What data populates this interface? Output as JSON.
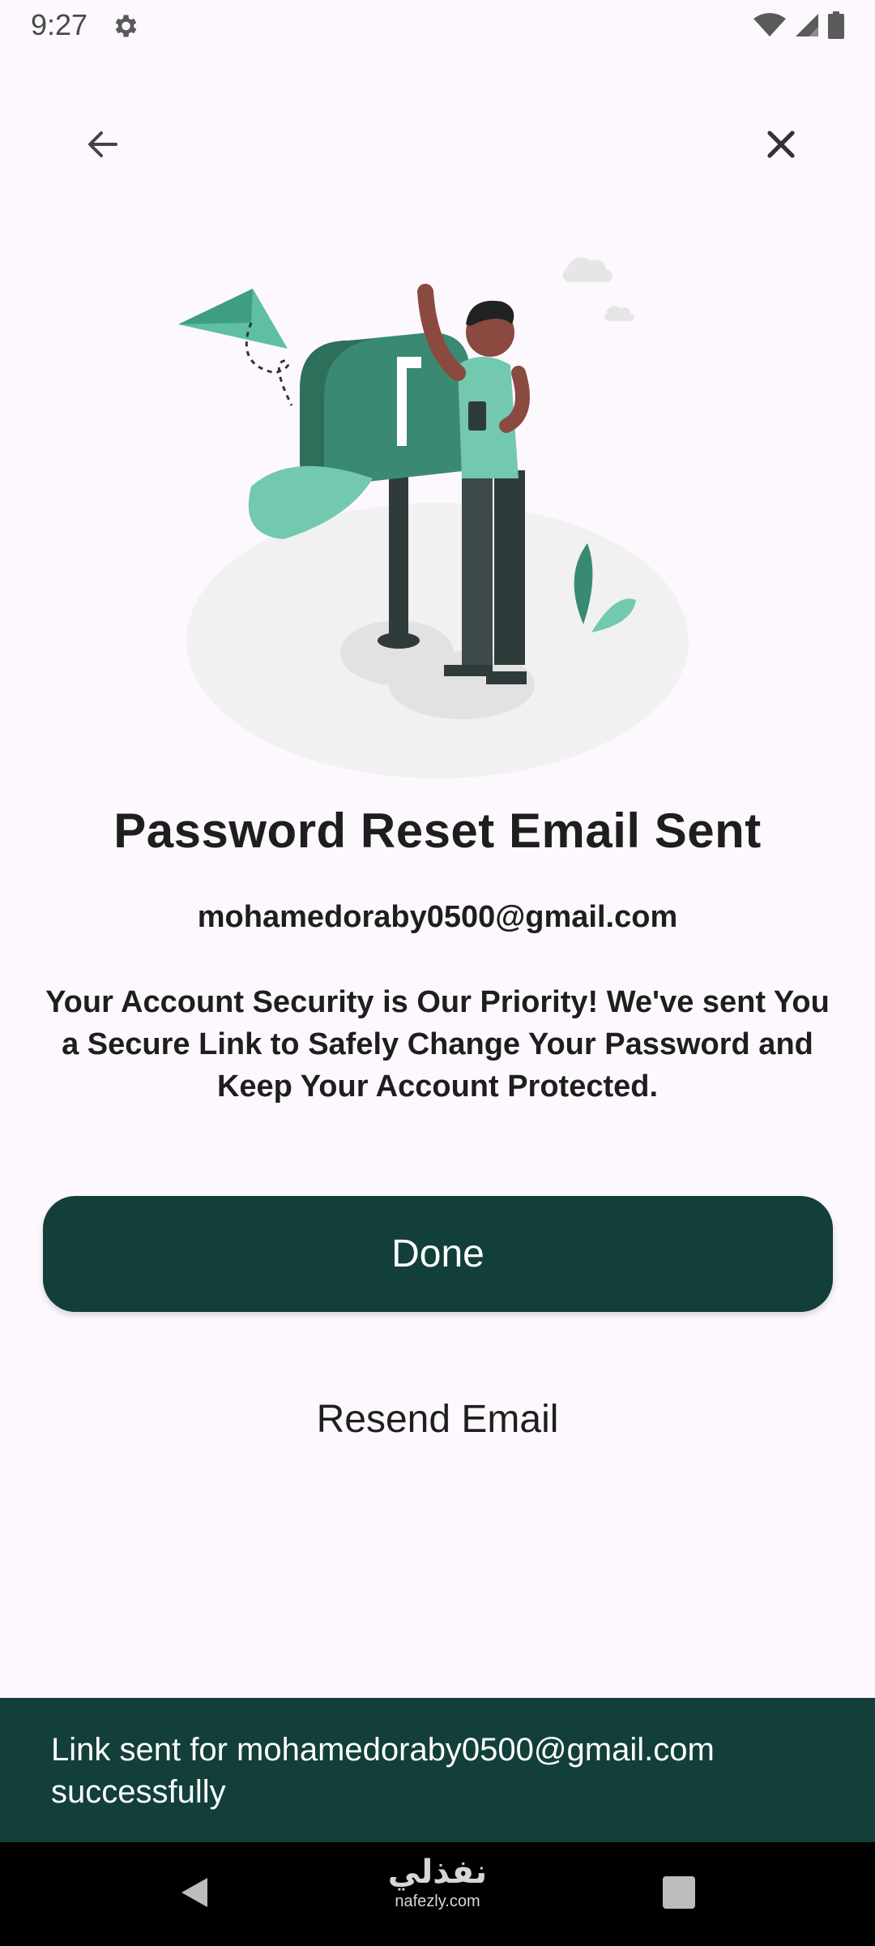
{
  "status_bar": {
    "time": "9:27",
    "icons": [
      "gear-icon",
      "wifi-icon",
      "signal-icon",
      "battery-icon"
    ]
  },
  "toolbar": {
    "back_icon": "arrow-left-icon",
    "close_icon": "close-icon"
  },
  "illustration": {
    "description_icon": "mailbox-person-illustration"
  },
  "content": {
    "title": "Password Reset Email Sent",
    "email": "mohamedoraby0500@gmail.com",
    "description": "Your Account Security is Our Priority! We've sent You a Secure Link to Safely Change Your Password and Keep Your Account Protected."
  },
  "actions": {
    "done_label": "Done",
    "resend_label": "Resend Email"
  },
  "snackbar": {
    "message": "Link sent for mohamedoraby0500@gmail.com successfully"
  },
  "watermark": {
    "arabic": "نفذلي",
    "latin": "nafezly.com"
  },
  "colors": {
    "primary": "#123f3a",
    "accent": "#5fbfa3",
    "background": "#fdf8fd"
  }
}
